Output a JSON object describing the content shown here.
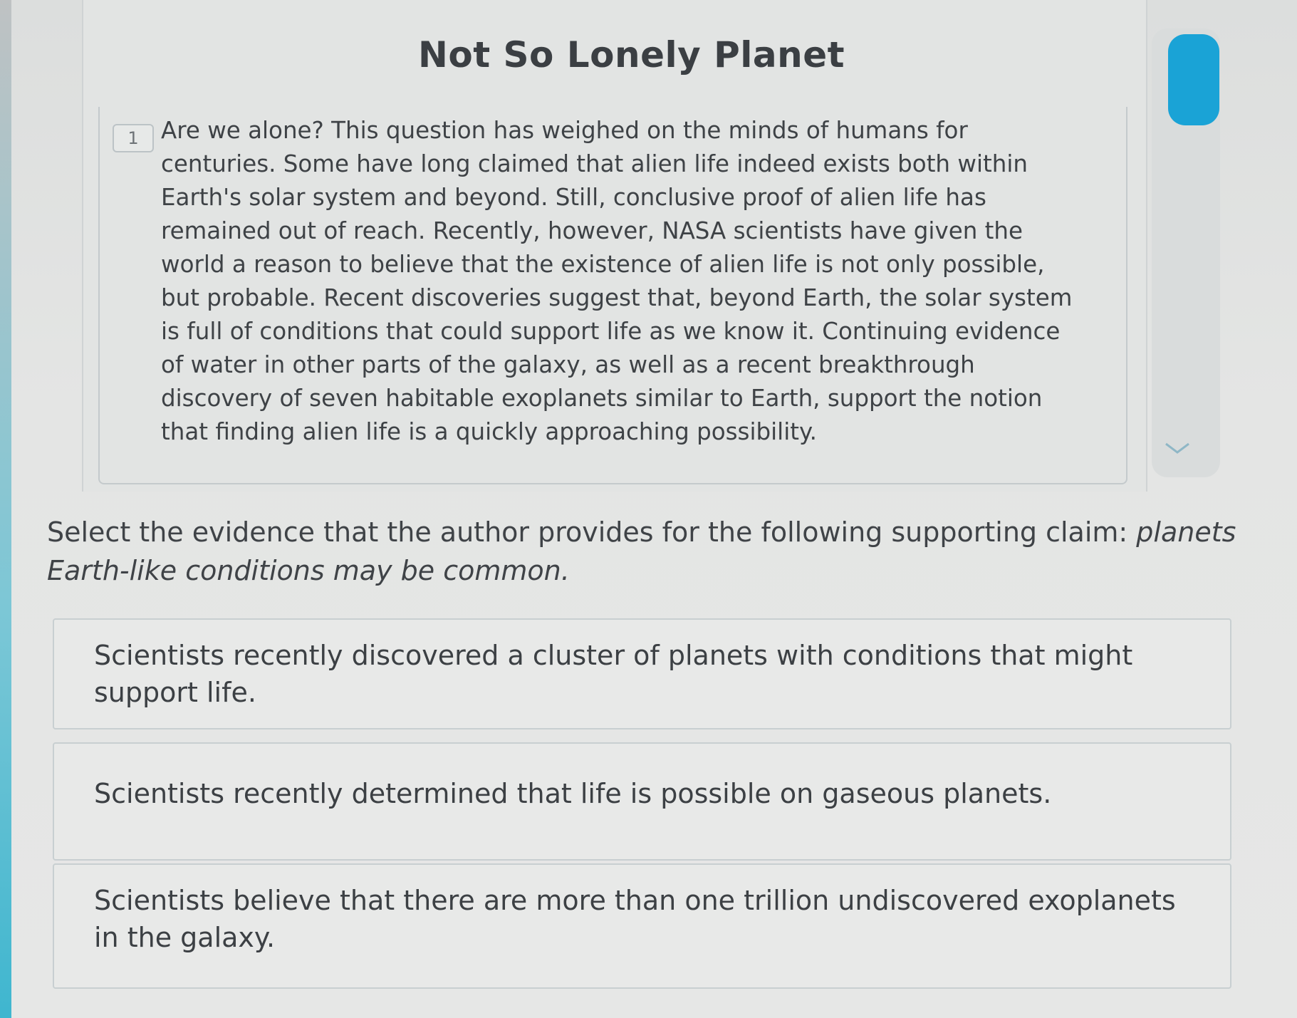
{
  "passage": {
    "title": "Not So Lonely Planet",
    "paragraph_number": "1",
    "paragraph_text": "Are we alone? This question has weighed on the minds of humans for centuries. Some have long claimed that alien life indeed exists both within Earth's solar system and beyond. Still, conclusive proof of alien life has remained out of reach. Recently, however, NASA scientists have given the world a reason to believe that the existence of alien life is not only possible, but probable. Recent discoveries suggest that, beyond Earth, the solar system is full of conditions that could support life as we know it. Continuing evidence of water in other parts of the galaxy, as well as a recent breakthrough discovery of seven habitable exoplanets similar to Earth, support the notion that finding alien life is a quickly approaching possibility."
  },
  "scrollbar": {
    "down_icon": "chevron-down-icon",
    "thumb_color": "#1aa3d6"
  },
  "question": {
    "prompt": "Select the evidence that the author provides for the following supporting claim: ",
    "claim": "planets Earth-like conditions may be common."
  },
  "choices": [
    {
      "text": "Scientists recently discovered a cluster of planets with conditions that might support life."
    },
    {
      "text": "Scientists recently determined that life is possible on gaseous planets."
    },
    {
      "text": "Scientists believe that there are more than one trillion undiscovered exoplanets in the galaxy."
    }
  ]
}
